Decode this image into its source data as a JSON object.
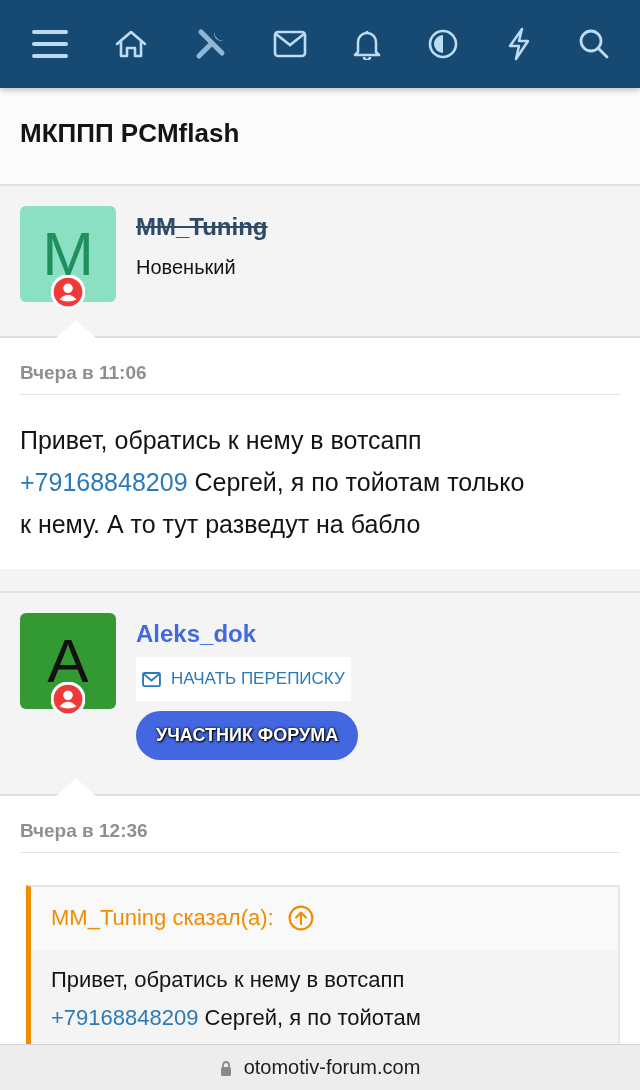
{
  "thread_title": "МКППП PCMflash",
  "posts": [
    {
      "author": {
        "name": "MM_Tuning",
        "initial": "M",
        "color": "#8be0c3",
        "banned": true,
        "role": "Новенький"
      },
      "date": "Вчера в 11:06",
      "body": [
        {
          "kind": "text",
          "text": "Привет, обратись к нему в вотсапп "
        },
        {
          "kind": "link",
          "text": "+79168848209"
        },
        {
          "kind": "text",
          "text": " Сергей, я по тойотам только к нему. А то тут разведут на бабло"
        }
      ]
    },
    {
      "author": {
        "name": "Aleks_dok",
        "initial": "A",
        "color": "#339933",
        "banned": false,
        "button": "НАЧАТЬ ПЕРЕПИСКУ",
        "banner": "УЧАСТНИК ФОРУМА"
      },
      "date": "Вчера в 12:36",
      "quote": {
        "header": "MM_Tuning сказал(а):",
        "body": [
          {
            "kind": "text",
            "text": "Привет, обратись к нему в вотсапп "
          },
          {
            "kind": "link",
            "text": "+79168848209"
          },
          {
            "kind": "text",
            "text": " Сергей, я по тойотам"
          }
        ]
      }
    }
  ],
  "url": "otomotiv-forum.com"
}
